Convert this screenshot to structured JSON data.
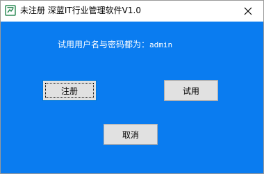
{
  "window": {
    "title": "未注册 深蓝IT行业管理软件V1.0"
  },
  "titlebar": {
    "icon": "app-window-icon",
    "close_icon": "close-icon"
  },
  "main": {
    "prompt_text": "试用用户名与密码都为：",
    "prompt_value": "admin"
  },
  "buttons": {
    "register_label": "注册",
    "trial_label": "试用",
    "cancel_label": "取消"
  },
  "colors": {
    "background": "#0a7cf0",
    "titlebar": "#ffffff",
    "button_face": "#e1e1e1"
  }
}
